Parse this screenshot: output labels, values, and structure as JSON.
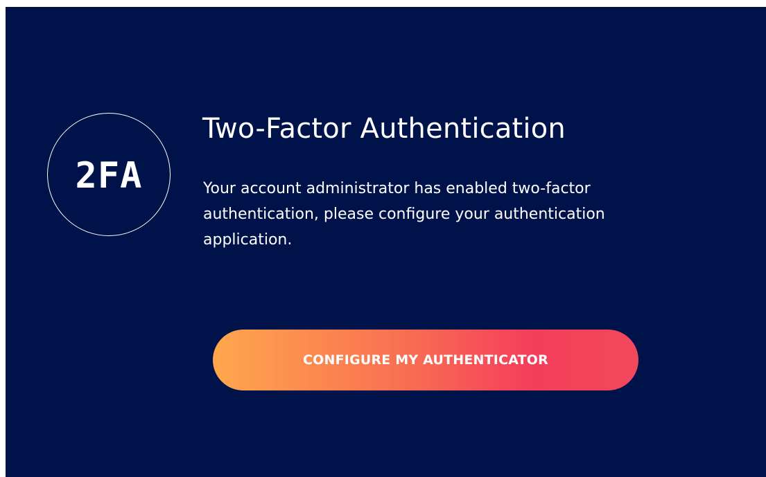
{
  "colors": {
    "panel_background": "#00124a",
    "text": "#ffffff",
    "button_gradient_start": "#ffa74c",
    "button_gradient_end": "#f2485c"
  },
  "badge": {
    "icon": "2fa-icon",
    "label": "2FA"
  },
  "header": {
    "title": "Two-Factor Authentication"
  },
  "body": {
    "message": "Your account administrator has enabled two-factor authentication, please configure your authentication application."
  },
  "actions": {
    "configure_label": "CONFIGURE MY AUTHENTICATOR"
  }
}
